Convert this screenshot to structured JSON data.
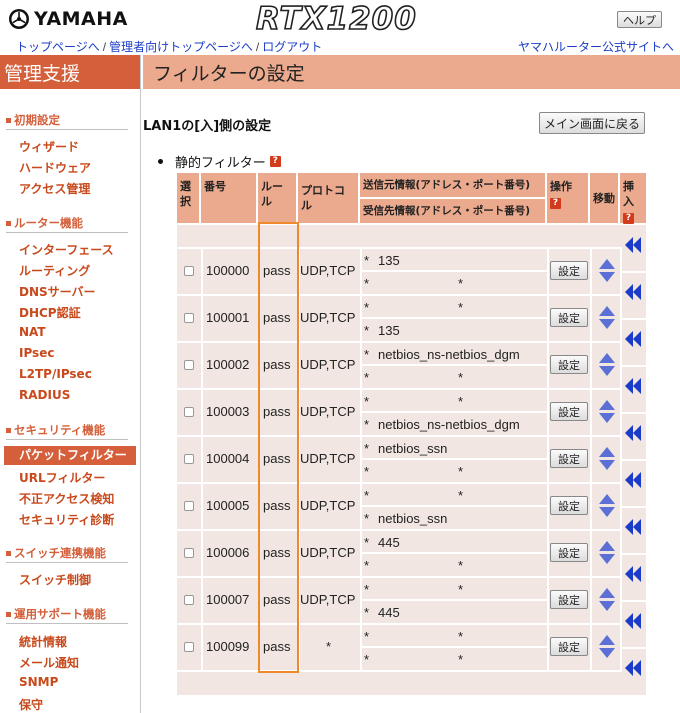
{
  "brand": {
    "logo_text": "YAMAHA",
    "model": "RTX1200",
    "help_label": "ヘルプ"
  },
  "nav": {
    "links": [
      "トップページへ",
      "管理者向けトップページへ",
      "ログアウト"
    ],
    "separator": "/",
    "right_link": "ヤマハルーター公式サイトへ"
  },
  "sidebar": {
    "title": "管理支援",
    "sections": [
      {
        "title": "初期設定",
        "items": [
          "ウィザード",
          "ハードウェア",
          "アクセス管理"
        ]
      },
      {
        "title": "ルーター機能",
        "items": [
          "インターフェース",
          "ルーティング",
          "DNSサーバー",
          "DHCP認証",
          "NAT",
          "IPsec",
          "L2TP/IPsec",
          "RADIUS"
        ]
      },
      {
        "title": "セキュリティ機能",
        "items": [
          "パケットフィルター",
          "URLフィルター",
          "不正アクセス検知",
          "セキュリティ診断"
        ]
      },
      {
        "title": "スイッチ連携機能",
        "items": [
          "スイッチ制御"
        ]
      },
      {
        "title": "運用サポート機能",
        "items": [
          "統計情報",
          "メール通知",
          "SNMP",
          "保守"
        ]
      }
    ],
    "active_item": "パケットフィルター"
  },
  "page": {
    "title": "フィルターの設定",
    "section_title": "LAN1の[入]側の設定",
    "main_button": "メイン画面に戻る",
    "static_filter_label": "静的フィルター",
    "help_icon_glyph": "?"
  },
  "table": {
    "headers": {
      "select": "選択",
      "number": "番号",
      "rule": "ルール",
      "protocol": "プロトコル",
      "source": "送信元情報(アドレス・ポート番号)",
      "dest": "受信先情報(アドレス・ポート番号)",
      "operation": "操作",
      "move": "移動",
      "insert": "挿入"
    },
    "set_label": "設定",
    "rows": [
      {
        "number": "100000",
        "rule": "pass",
        "protocol": "UDP,TCP",
        "src_addr": "*",
        "src_port": "135",
        "dst_addr": "*",
        "dst_port": "*"
      },
      {
        "number": "100001",
        "rule": "pass",
        "protocol": "UDP,TCP",
        "src_addr": "*",
        "src_port": "*",
        "dst_addr": "*",
        "dst_port": "135"
      },
      {
        "number": "100002",
        "rule": "pass",
        "protocol": "UDP,TCP",
        "src_addr": "*",
        "src_port": "netbios_ns-netbios_dgm",
        "dst_addr": "*",
        "dst_port": "*"
      },
      {
        "number": "100003",
        "rule": "pass",
        "protocol": "UDP,TCP",
        "src_addr": "*",
        "src_port": "*",
        "dst_addr": "*",
        "dst_port": "netbios_ns-netbios_dgm"
      },
      {
        "number": "100004",
        "rule": "pass",
        "protocol": "UDP,TCP",
        "src_addr": "*",
        "src_port": "netbios_ssn",
        "dst_addr": "*",
        "dst_port": "*"
      },
      {
        "number": "100005",
        "rule": "pass",
        "protocol": "UDP,TCP",
        "src_addr": "*",
        "src_port": "*",
        "dst_addr": "*",
        "dst_port": "netbios_ssn"
      },
      {
        "number": "100006",
        "rule": "pass",
        "protocol": "UDP,TCP",
        "src_addr": "*",
        "src_port": "445",
        "dst_addr": "*",
        "dst_port": "*"
      },
      {
        "number": "100007",
        "rule": "pass",
        "protocol": "UDP,TCP",
        "src_addr": "*",
        "src_port": "*",
        "dst_addr": "*",
        "dst_port": "445"
      },
      {
        "number": "100099",
        "rule": "pass",
        "protocol": "*",
        "src_addr": "*",
        "src_port": "*",
        "dst_addr": "*",
        "dst_port": "*"
      }
    ]
  },
  "colors": {
    "accent_dark": "#d45f3a",
    "accent_light": "#eba98d",
    "table_bg": "#f1e6e1",
    "link": "#1a3cc8",
    "move_arrow": "#5b6fd4",
    "insert_arrow": "#1a3cc8",
    "highlight_box": "#f0892c"
  }
}
